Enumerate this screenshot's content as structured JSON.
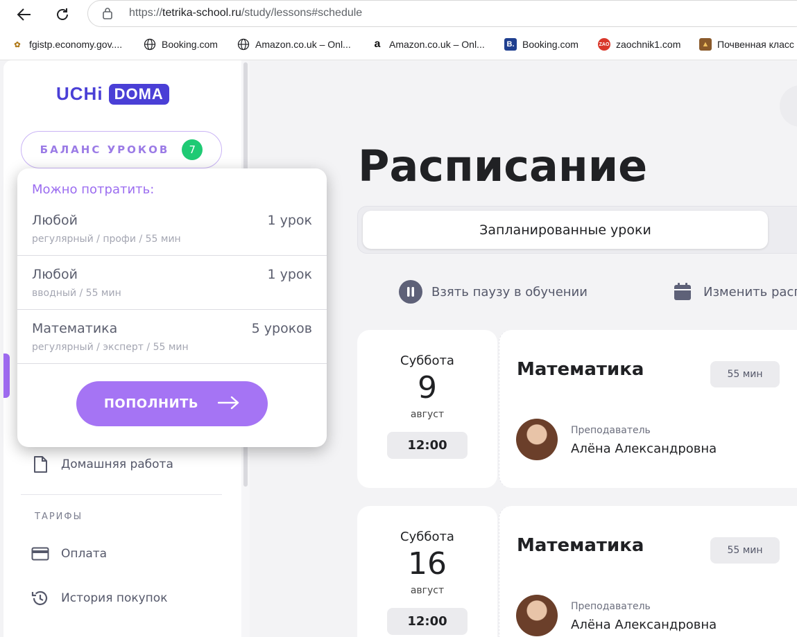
{
  "browser": {
    "url_prefix": "https://",
    "url_host": "tetrika-school.ru",
    "url_path": "/study/lessons#schedule",
    "bookmarks": [
      {
        "label": "fgistp.economy.gov....",
        "icon": "emblem-icon"
      },
      {
        "label": "Booking.com",
        "icon": "globe-icon"
      },
      {
        "label": "Amazon.co.uk – Onl...",
        "icon": "globe-icon"
      },
      {
        "label": "Amazon.co.uk – Onl...",
        "icon": "amazon-icon"
      },
      {
        "label": "Booking.com",
        "icon": "booking-icon"
      },
      {
        "label": "zaochnik1.com",
        "icon": "zao-icon"
      },
      {
        "label": "Почвенная класс",
        "icon": "folder-icon"
      }
    ]
  },
  "sidebar": {
    "logo_left": "UCHi",
    "logo_right": "DOMA",
    "balance_label": "БАЛАНС УРОКОВ",
    "balance_count": "7",
    "items": [
      {
        "label": "Домашняя работа",
        "icon": "document-icon"
      }
    ],
    "section_title": "ТАРИФЫ",
    "tariff_items": [
      {
        "label": "Оплата",
        "icon": "credit-card-icon"
      },
      {
        "label": "История покупок",
        "icon": "history-icon"
      }
    ]
  },
  "popover": {
    "title": "Можно потратить:",
    "rows": [
      {
        "name": "Любой",
        "count": "1 урок",
        "sub": "регулярный / профи / 55 мин"
      },
      {
        "name": "Любой",
        "count": "1 урок",
        "sub": "вводный / 55 мин"
      },
      {
        "name": "Математика",
        "count": "5 уроков",
        "sub": "регулярный / эксперт / 55 мин"
      }
    ],
    "button_label": "ПОПОЛНИТЬ"
  },
  "main": {
    "title": "Расписание",
    "tab_active": "Запланированные уроки",
    "actions": [
      {
        "label": "Взять паузу в обучении",
        "icon": "pause-icon"
      },
      {
        "label": "Изменить расп",
        "icon": "calendar-icon"
      }
    ],
    "lessons": [
      {
        "day": "Суббота",
        "date": "9",
        "month": "август",
        "time": "12:00",
        "subject": "Математика",
        "duration": "55 мин",
        "role": "Преподаватель",
        "teacher": "Алёна Александровна"
      },
      {
        "day": "Суббота",
        "date": "16",
        "month": "август",
        "time": "12:00",
        "subject": "Математика",
        "duration": "55 мин",
        "role": "Преподаватель",
        "teacher": "Алёна Александровна"
      }
    ]
  },
  "colors": {
    "accent": "#a574f4",
    "brand": "#4a3fd6",
    "badge": "#1fca74"
  }
}
